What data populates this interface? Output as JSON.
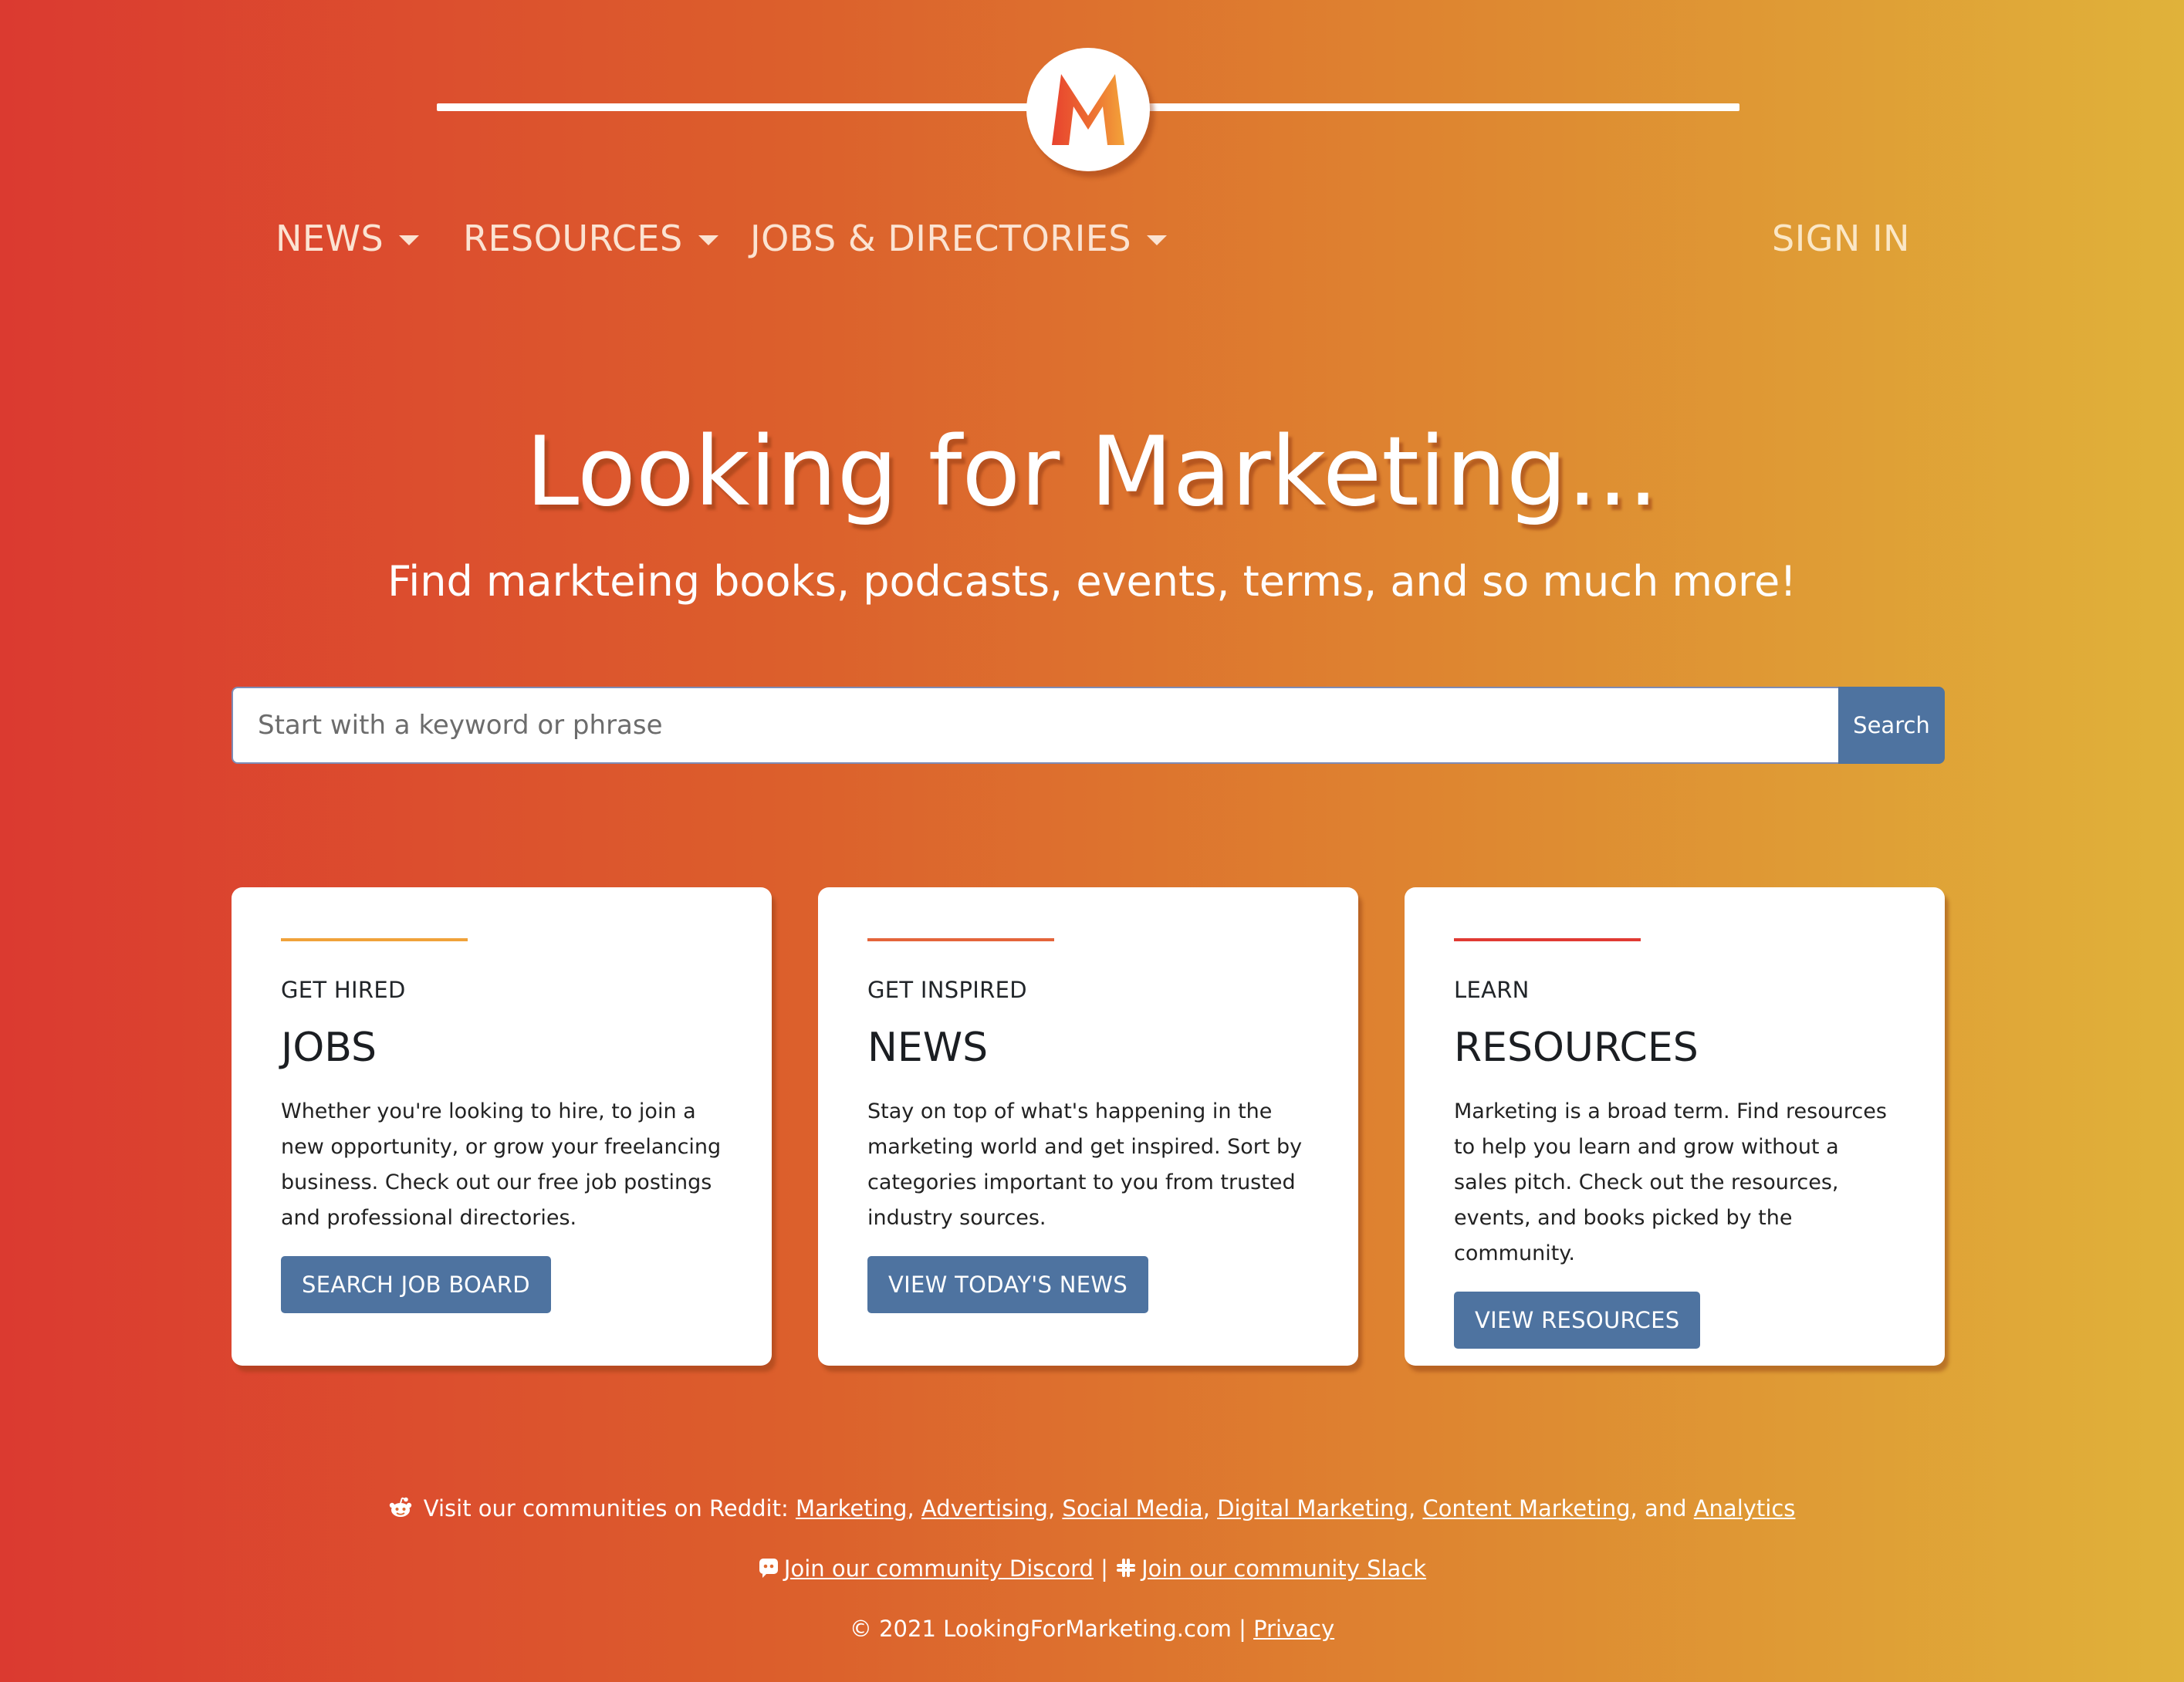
{
  "nav": {
    "news": "NEWS",
    "resources": "RESOURCES",
    "jobs": "JOBS & DIRECTORIES",
    "signin": "SIGN IN"
  },
  "hero": {
    "title": "Looking for Marketing...",
    "subtitle": "Find markteing books, podcasts, events, terms, and so much more!"
  },
  "search": {
    "placeholder": "Start with a keyword or phrase",
    "button": "Search"
  },
  "colors": {
    "accent_orange": "#f0a23a",
    "accent_redorange": "#e4643a",
    "accent_red": "#e03a33",
    "button_blue": "#4e73a0"
  },
  "cards": [
    {
      "eyebrow": "GET HIRED",
      "title": "JOBS",
      "body": "Whether you're looking to hire, to join a new opportunity, or grow your freelancing business. Check out our free job postings and professional directories.",
      "button": "SEARCH JOB BOARD"
    },
    {
      "eyebrow": "GET INSPIRED",
      "title": "NEWS",
      "body": "Stay on top of what's happening in the marketing world and get inspired. Sort by categories important to you from trusted industry sources.",
      "button": "VIEW TODAY'S NEWS"
    },
    {
      "eyebrow": "LEARN",
      "title": "RESOURCES",
      "body": "Marketing is a broad term. Find resources to help you learn and grow without a sales pitch. Check out the resources, events, and books picked by the community.",
      "button": "VIEW RESOURCES"
    }
  ],
  "footer": {
    "reddit_intro": "Visit our communities on Reddit:",
    "reddit_links": [
      "Marketing",
      "Advertising",
      "Social Media",
      "Digital Marketing",
      "Content Marketing"
    ],
    "reddit_and": "and",
    "reddit_last": "Analytics",
    "discord": "Join our community Discord",
    "separator": "|",
    "slack": "Join our community Slack",
    "copyright": "© 2021 LookingForMarketing.com",
    "privacy": "Privacy"
  }
}
